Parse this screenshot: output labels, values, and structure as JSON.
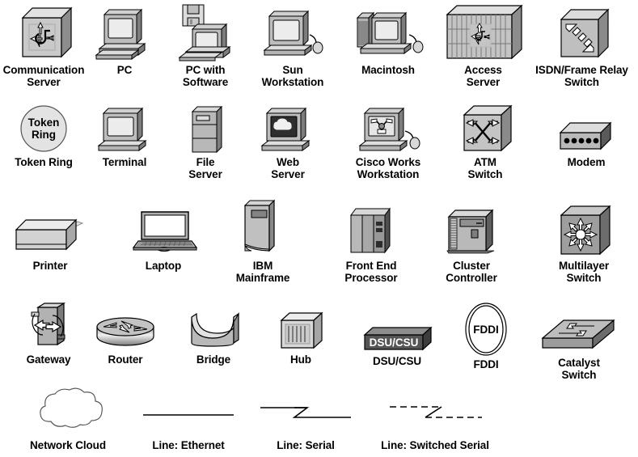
{
  "document": {
    "title": "Cisco Network Topology Icon Legend",
    "background_color": "#ffffff",
    "text_color": "#000000",
    "palette": {
      "light_gray": "#e8e8e8",
      "mid_gray": "#b4b4b4",
      "dark_gray": "#8a8a8a",
      "darker_gray": "#6e6e6e",
      "shadow_gray": "#555555",
      "outline": "#000000",
      "white": "#ffffff"
    }
  },
  "rows": [
    {
      "row_index": 1,
      "items": [
        {
          "id": "communication-server",
          "label": "Communication\nServer",
          "icon": "communication-server-icon"
        },
        {
          "id": "pc",
          "label": "PC",
          "icon": "pc-icon"
        },
        {
          "id": "pc-with-software",
          "label": "PC with\nSoftware",
          "icon": "pc-with-software-icon"
        },
        {
          "id": "sun-workstation",
          "label": "Sun\nWorkstation",
          "icon": "sun-workstation-icon"
        },
        {
          "id": "macintosh",
          "label": "Macintosh",
          "icon": "macintosh-icon"
        },
        {
          "id": "access-server",
          "label": "Access\nServer",
          "icon": "access-server-icon"
        },
        {
          "id": "isdn-frame-relay-switch",
          "label": "ISDN/Frame Relay\nSwitch",
          "icon": "isdn-frame-relay-switch-icon"
        }
      ]
    },
    {
      "row_index": 2,
      "items": [
        {
          "id": "token-ring",
          "label": "Token Ring",
          "icon": "token-ring-icon",
          "icon_text": "Token\nRing"
        },
        {
          "id": "terminal",
          "label": "Terminal",
          "icon": "terminal-icon"
        },
        {
          "id": "file-server",
          "label": "File\nServer",
          "icon": "file-server-icon"
        },
        {
          "id": "web-server",
          "label": "Web\nServer",
          "icon": "web-server-icon"
        },
        {
          "id": "cisco-works-workstation",
          "label": "Cisco Works\nWorkstation",
          "icon": "cisco-works-workstation-icon"
        },
        {
          "id": "atm-switch",
          "label": "ATM\nSwitch",
          "icon": "atm-switch-icon"
        },
        {
          "id": "modem",
          "label": "Modem",
          "icon": "modem-icon"
        }
      ]
    },
    {
      "row_index": 3,
      "items": [
        {
          "id": "printer",
          "label": "Printer",
          "icon": "printer-icon"
        },
        {
          "id": "laptop",
          "label": "Laptop",
          "icon": "laptop-icon"
        },
        {
          "id": "ibm-mainframe",
          "label": "IBM\nMainframe",
          "icon": "ibm-mainframe-icon"
        },
        {
          "id": "front-end-processor",
          "label": "Front End\nProcessor",
          "icon": "front-end-processor-icon"
        },
        {
          "id": "cluster-controller",
          "label": "Cluster\nController",
          "icon": "cluster-controller-icon"
        },
        {
          "id": "multilayer-switch",
          "label": "Multilayer\nSwitch",
          "icon": "multilayer-switch-icon"
        }
      ]
    },
    {
      "row_index": 4,
      "items": [
        {
          "id": "gateway",
          "label": "Gateway",
          "icon": "gateway-icon"
        },
        {
          "id": "router",
          "label": "Router",
          "icon": "router-icon"
        },
        {
          "id": "bridge",
          "label": "Bridge",
          "icon": "bridge-icon"
        },
        {
          "id": "hub",
          "label": "Hub",
          "icon": "hub-icon"
        },
        {
          "id": "dsu-csu",
          "label": "DSU/CSU",
          "icon": "dsu-csu-icon",
          "icon_text": "DSU/CSU"
        },
        {
          "id": "fddi",
          "label": "FDDI",
          "icon": "fddi-icon",
          "icon_text": "FDDI"
        },
        {
          "id": "catalyst-switch",
          "label": "Catalyst\nSwitch",
          "icon": "catalyst-switch-icon"
        }
      ]
    },
    {
      "row_index": 5,
      "items": [
        {
          "id": "network-cloud",
          "label": "Network Cloud",
          "icon": "network-cloud-icon"
        },
        {
          "id": "line-ethernet",
          "label": "Line: Ethernet",
          "icon": "line-ethernet-icon"
        },
        {
          "id": "line-serial",
          "label": "Line: Serial",
          "icon": "line-serial-icon"
        },
        {
          "id": "line-switched-serial",
          "label": "Line: Switched Serial",
          "icon": "line-switched-serial-icon"
        }
      ]
    }
  ]
}
